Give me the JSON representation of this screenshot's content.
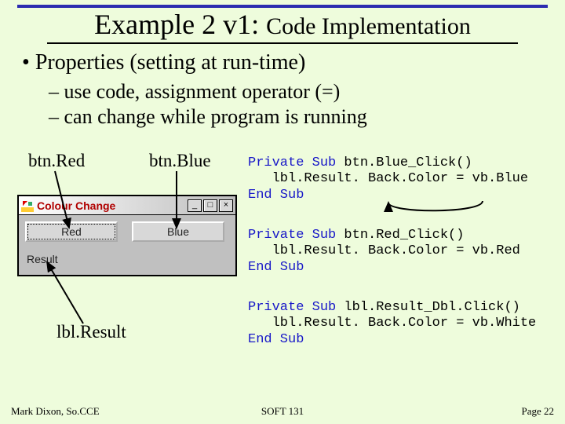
{
  "title_main": "Example 2 v1: ",
  "title_sub": "Code Implementation",
  "bullet1": "Properties (setting at run-time)",
  "bullet2a": "use code, assignment operator (=)",
  "bullet2b": "can change while program is running",
  "labels": {
    "btnRed": "btn.Red",
    "btnBlue": "btn.Blue",
    "lblResult": "lbl.Result"
  },
  "vbwin": {
    "title": "Colour Change",
    "btnRed": "Red",
    "btnBlue": "Blue",
    "result": "Result"
  },
  "code1": {
    "l1a": "Private Sub",
    "l1b": " btn.Blue_Click()",
    "l2": "   lbl.Result. Back.Color = vb.Blue",
    "l3": "End Sub"
  },
  "code2": {
    "l1a": "Private Sub",
    "l1b": " btn.Red_Click()",
    "l2": "   lbl.Result. Back.Color = vb.Red",
    "l3": "End Sub"
  },
  "code3": {
    "l1a": "Private Sub",
    "l1b": " lbl.Result_Dbl.Click()",
    "l2": "   lbl.Result. Back.Color = vb.White",
    "l3": "End Sub"
  },
  "footer": {
    "left": "Mark Dixon, So.CCE",
    "center": "SOFT 131",
    "right": "Page 22"
  }
}
